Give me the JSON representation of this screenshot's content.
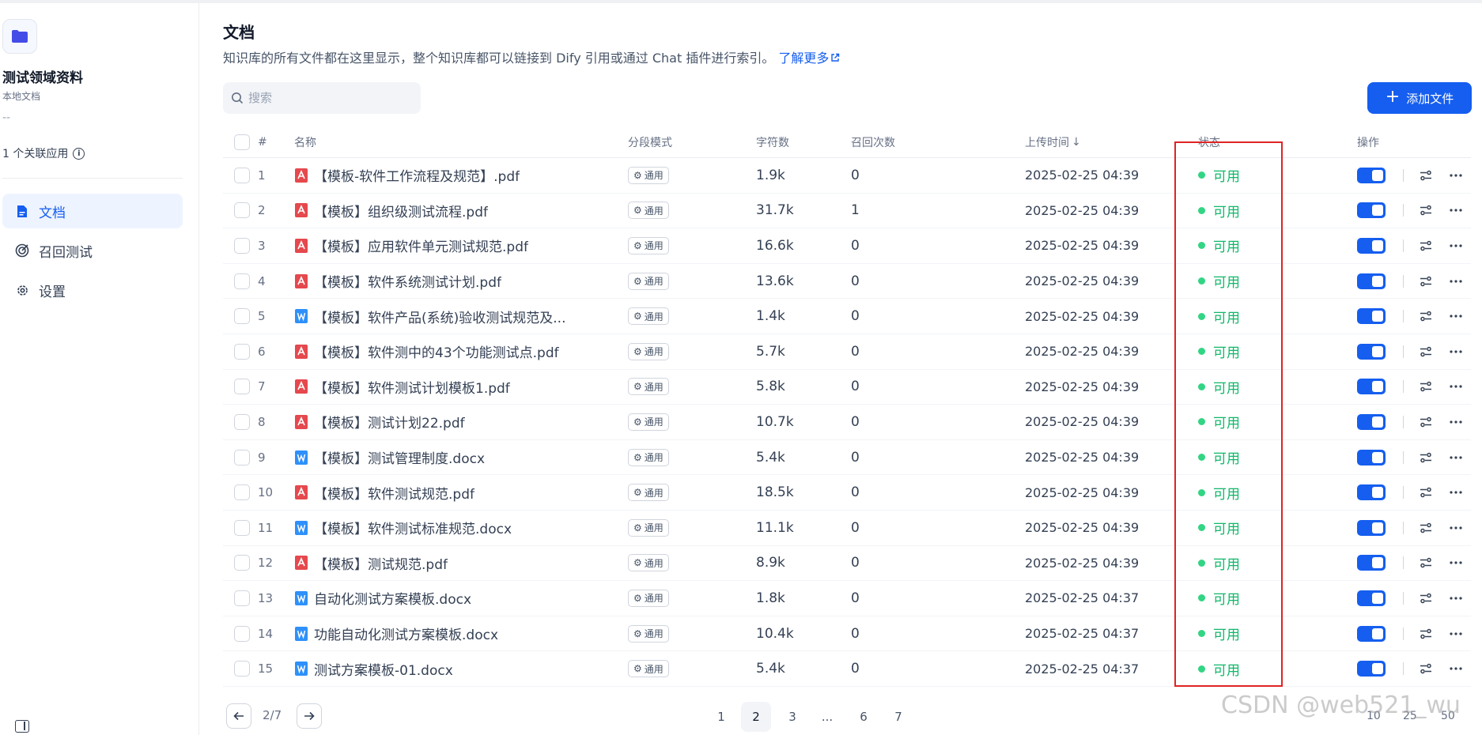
{
  "sidebar": {
    "dataset_name": "测试领域资料",
    "dataset_type": "本地文档",
    "dataset_desc": "--",
    "linked_apps": "1 个关联应用",
    "nav": [
      {
        "label": "文档",
        "icon": "document-icon",
        "active": true
      },
      {
        "label": "召回测试",
        "icon": "target-icon",
        "active": false
      },
      {
        "label": "设置",
        "icon": "gear-icon",
        "active": false
      }
    ]
  },
  "header": {
    "title": "文档",
    "description": "知识库的所有文件都在这里显示，整个知识库都可以链接到 Dify 引用或通过 Chat 插件进行索引。",
    "learn_more": "了解更多"
  },
  "search": {
    "placeholder": "搜索",
    "value": ""
  },
  "toolbar": {
    "add_file_label": "添加文件"
  },
  "table": {
    "columns": {
      "index": "#",
      "name": "名称",
      "mode": "分段模式",
      "chars": "字符数",
      "hits": "召回次数",
      "upload_time": "上传时间",
      "sort_arrow": "↓",
      "status": "状态",
      "actions": "操作"
    },
    "rows": [
      {
        "index": "1",
        "name": "【模板-软件工作流程及规范】.pdf",
        "type": "pdf",
        "mode": "通用",
        "chars": "1.9k",
        "hits": "0",
        "time": "2025-02-25 04:39",
        "status": "可用"
      },
      {
        "index": "2",
        "name": "【模板】组织级测试流程.pdf",
        "type": "pdf",
        "mode": "通用",
        "chars": "31.7k",
        "hits": "1",
        "time": "2025-02-25 04:39",
        "status": "可用"
      },
      {
        "index": "3",
        "name": "【模板】应用软件单元测试规范.pdf",
        "type": "pdf",
        "mode": "通用",
        "chars": "16.6k",
        "hits": "0",
        "time": "2025-02-25 04:39",
        "status": "可用"
      },
      {
        "index": "4",
        "name": "【模板】软件系统测试计划.pdf",
        "type": "pdf",
        "mode": "通用",
        "chars": "13.6k",
        "hits": "0",
        "time": "2025-02-25 04:39",
        "status": "可用"
      },
      {
        "index": "5",
        "name": "【模板】软件产品(系统)验收测试规范及...",
        "type": "docx",
        "mode": "通用",
        "chars": "1.4k",
        "hits": "0",
        "time": "2025-02-25 04:39",
        "status": "可用"
      },
      {
        "index": "6",
        "name": "【模板】软件测中的43个功能测试点.pdf",
        "type": "pdf",
        "mode": "通用",
        "chars": "5.7k",
        "hits": "0",
        "time": "2025-02-25 04:39",
        "status": "可用"
      },
      {
        "index": "7",
        "name": "【模板】软件测试计划模板1.pdf",
        "type": "pdf",
        "mode": "通用",
        "chars": "5.8k",
        "hits": "0",
        "time": "2025-02-25 04:39",
        "status": "可用"
      },
      {
        "index": "8",
        "name": "【模板】测试计划22.pdf",
        "type": "pdf",
        "mode": "通用",
        "chars": "10.7k",
        "hits": "0",
        "time": "2025-02-25 04:39",
        "status": "可用"
      },
      {
        "index": "9",
        "name": "【模板】测试管理制度.docx",
        "type": "docx",
        "mode": "通用",
        "chars": "5.4k",
        "hits": "0",
        "time": "2025-02-25 04:39",
        "status": "可用"
      },
      {
        "index": "10",
        "name": "【模板】软件测试规范.pdf",
        "type": "pdf",
        "mode": "通用",
        "chars": "18.5k",
        "hits": "0",
        "time": "2025-02-25 04:39",
        "status": "可用"
      },
      {
        "index": "11",
        "name": "【模板】软件测试标准规范.docx",
        "type": "docx",
        "mode": "通用",
        "chars": "11.1k",
        "hits": "0",
        "time": "2025-02-25 04:39",
        "status": "可用"
      },
      {
        "index": "12",
        "name": "【模板】测试规范.pdf",
        "type": "pdf",
        "mode": "通用",
        "chars": "8.9k",
        "hits": "0",
        "time": "2025-02-25 04:39",
        "status": "可用"
      },
      {
        "index": "13",
        "name": "自动化测试方案模板.docx",
        "type": "docx",
        "mode": "通用",
        "chars": "1.8k",
        "hits": "0",
        "time": "2025-02-25 04:37",
        "status": "可用"
      },
      {
        "index": "14",
        "name": "功能自动化测试方案模板.docx",
        "type": "docx",
        "mode": "通用",
        "chars": "10.4k",
        "hits": "0",
        "time": "2025-02-25 04:37",
        "status": "可用"
      },
      {
        "index": "15",
        "name": "测试方案模板-01.docx",
        "type": "docx",
        "mode": "通用",
        "chars": "5.4k",
        "hits": "0",
        "time": "2025-02-25 04:37",
        "status": "可用"
      }
    ]
  },
  "pagination": {
    "current": "2/7",
    "pages": [
      "1",
      "2",
      "3",
      "...",
      "6",
      "7"
    ],
    "active_page": "2",
    "per_page": [
      "10",
      "25",
      "50"
    ]
  },
  "watermark": "CSDN @web521_wu",
  "colors": {
    "accent": "#155eef",
    "status_ok": "#12b76a",
    "highlight": "#e02424",
    "pdf_icon": "#e5484d",
    "docx_icon": "#2e90fa"
  }
}
